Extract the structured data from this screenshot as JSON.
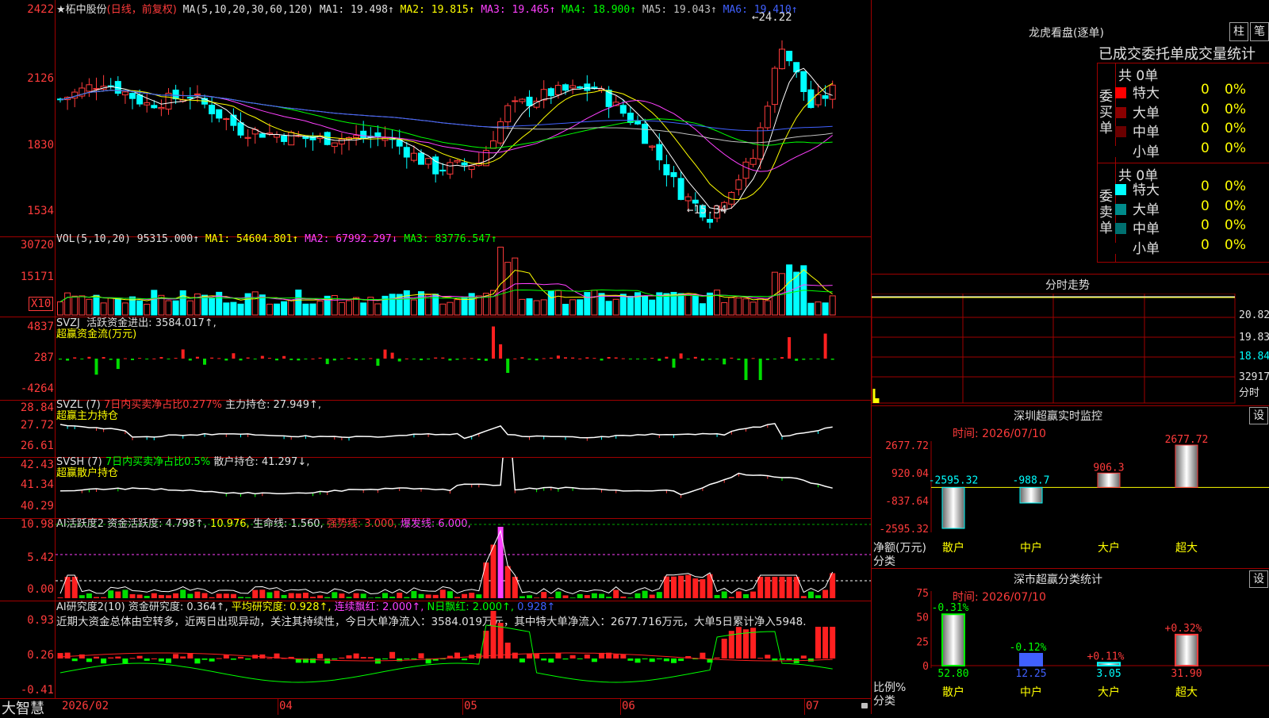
{
  "stock": {
    "name": "柘中股份",
    "mode": "(日线，前复权)",
    "ma_label": "MA(5,10,20,30,60,120)",
    "ma": [
      {
        "label": "MA1:",
        "value": "19.498↑",
        "color": "#e0e0e0"
      },
      {
        "label": "MA2:",
        "value": "19.815↑",
        "color": "#ffff00"
      },
      {
        "label": "MA3:",
        "value": "19.465↑",
        "color": "#ff40ff"
      },
      {
        "label": "MA4:",
        "value": "18.900↑",
        "color": "#00ff00"
      },
      {
        "label": "MA5:",
        "value": "19.043↑",
        "color": "#c0c0c0"
      },
      {
        "label": "MA6:",
        "value": "19.410↑",
        "color": "#4060ff"
      }
    ],
    "high_label": "24.22",
    "low_label": "15.34",
    "price_axis": [
      "2422",
      "2126",
      "1830",
      "1534"
    ]
  },
  "vol": {
    "title": "VOL(5,10,20)",
    "value": "95315.000↑",
    "ma1": "MA1: 54604.801↑",
    "ma2": "MA2: 67992.297↓",
    "ma3": "MA3: 83776.547↑",
    "axis": [
      "30720",
      "15171"
    ],
    "unit": "X10"
  },
  "svzj": {
    "title": "SVZJ",
    "line1_label": "活跃资金进出:",
    "line1_value": "3584.017↑,",
    "line2": "超赢资金流(万元)",
    "axis": [
      "4837",
      "287",
      "-4264"
    ]
  },
  "svzl": {
    "title": "SVZL (7)",
    "net": "7日内买卖净占比0.277%",
    "hold": "主力持仓: 27.949↑,",
    "line2": "超赢主力持仓",
    "axis": [
      "28.84",
      "27.72",
      "26.61"
    ]
  },
  "svsh": {
    "title": "SVSH (7)",
    "net": "7日内买卖净占比0.5%",
    "hold": "散户持仓: 41.297↓,",
    "line2": "超赢散户持仓",
    "axis": [
      "42.43",
      "41.34",
      "40.29"
    ]
  },
  "ai_active": {
    "title": "AI活跃度2",
    "a": "资金活跃度: 4.798↑,",
    "b": "10.976,",
    "c": "生命线: 1.560,",
    "d": "强势线: 3.000,",
    "e": "爆发线: 6.000,",
    "axis": [
      "10.98",
      "5.42",
      "0.00"
    ]
  },
  "ai_research": {
    "title": "AI研究度2(10)",
    "a": "资金研究度: 0.364↑,",
    "b": "平均研究度: 0.928↑,",
    "c": "连续飘红: 2.000↑,",
    "d": "N日飘红: 2.000↑,",
    "e": "0.928↑",
    "comment": "近期大资金总体由空转多，近两日出现异动，关注其持续性，今日大单净流入：3584.019万元，其中特大单净流入：2677.716万元，大单5日累计净入5948.",
    "axis": [
      "0.93",
      "0.26",
      "-0.41"
    ]
  },
  "timeline": {
    "logo": "大智慧",
    "labels": [
      "2026/02",
      "04",
      "05",
      "06",
      "07"
    ]
  },
  "longhu": {
    "title": "龙虎看盘(逐单)",
    "btn1": "柱",
    "btn2": "笔",
    "subtitle": "已成交委托单成交量统计",
    "buy": {
      "side": "委买单",
      "count": "共 0单",
      "rows": [
        {
          "label": "特大",
          "color": "#ff0000",
          "value": "0",
          "pct": "0%"
        },
        {
          "label": "大单",
          "color": "#8b0000",
          "value": "0",
          "pct": "0%"
        },
        {
          "label": "中单",
          "color": "#6b0000",
          "value": "0",
          "pct": "0%"
        },
        {
          "label": "小单",
          "color": "#000000",
          "value": "0",
          "pct": "0%"
        }
      ]
    },
    "sell": {
      "side": "委卖单",
      "count": "共 0单",
      "rows": [
        {
          "label": "特大",
          "color": "#00ffff",
          "value": "0",
          "pct": "0%"
        },
        {
          "label": "大单",
          "color": "#008b8b",
          "value": "0",
          "pct": "0%"
        },
        {
          "label": "中单",
          "color": "#007070",
          "value": "0",
          "pct": "0%"
        },
        {
          "label": "小单",
          "color": "#000000",
          "value": "0",
          "pct": "0%"
        }
      ]
    }
  },
  "fenshi": {
    "title": "分时走势",
    "axis": [
      "20.82",
      "19.83",
      "18.84"
    ],
    "vol_label": "32917",
    "fen_label": "分时"
  },
  "sz_monitor": {
    "title": "深圳超赢实时监控",
    "btn": "设",
    "time": "时间: 2026/07/10",
    "axis": [
      "2677.72",
      "920.04",
      "-837.64",
      "-2595.32"
    ],
    "ylabel": "净额(万元)",
    "xlabel": "分类",
    "categories": [
      "散户",
      "中户",
      "大户",
      "超大"
    ],
    "value_labels": [
      "-2595.32",
      "-988.7",
      "906.3",
      "2677.72"
    ]
  },
  "sz_class": {
    "title": "深市超赢分类统计",
    "btn": "设",
    "time": "时间: 2026/07/10",
    "axis": [
      "75",
      "50",
      "25",
      "0"
    ],
    "ylabel": "比例%",
    "xlabel": "分类",
    "categories": [
      "散户",
      "中户",
      "大户",
      "超大"
    ],
    "pct_labels": [
      "-0.31%",
      "-0.12%",
      "+0.11%",
      "+0.32%"
    ],
    "value_labels": [
      "52.80",
      "12.25",
      "3.05",
      "31.90"
    ]
  },
  "chart_data": {
    "type": "bar",
    "title": "深圳超赢实时监控",
    "categories": [
      "散户",
      "中户",
      "大户",
      "超大"
    ],
    "series": [
      {
        "name": "净额(万元)",
        "values": [
          -2595.32,
          -988.7,
          906.3,
          2677.72
        ]
      }
    ],
    "ylabel": "净额(万元)",
    "xlabel": "分类",
    "ylim": [
      -2595.32,
      2677.72
    ],
    "grid": false
  },
  "chart_data_ratio": {
    "type": "bar",
    "title": "深市超赢分类统计",
    "categories": [
      "散户",
      "中户",
      "大户",
      "超大"
    ],
    "values": [
      52.8,
      12.25,
      3.05,
      31.9
    ],
    "ylim": [
      0,
      75
    ]
  }
}
